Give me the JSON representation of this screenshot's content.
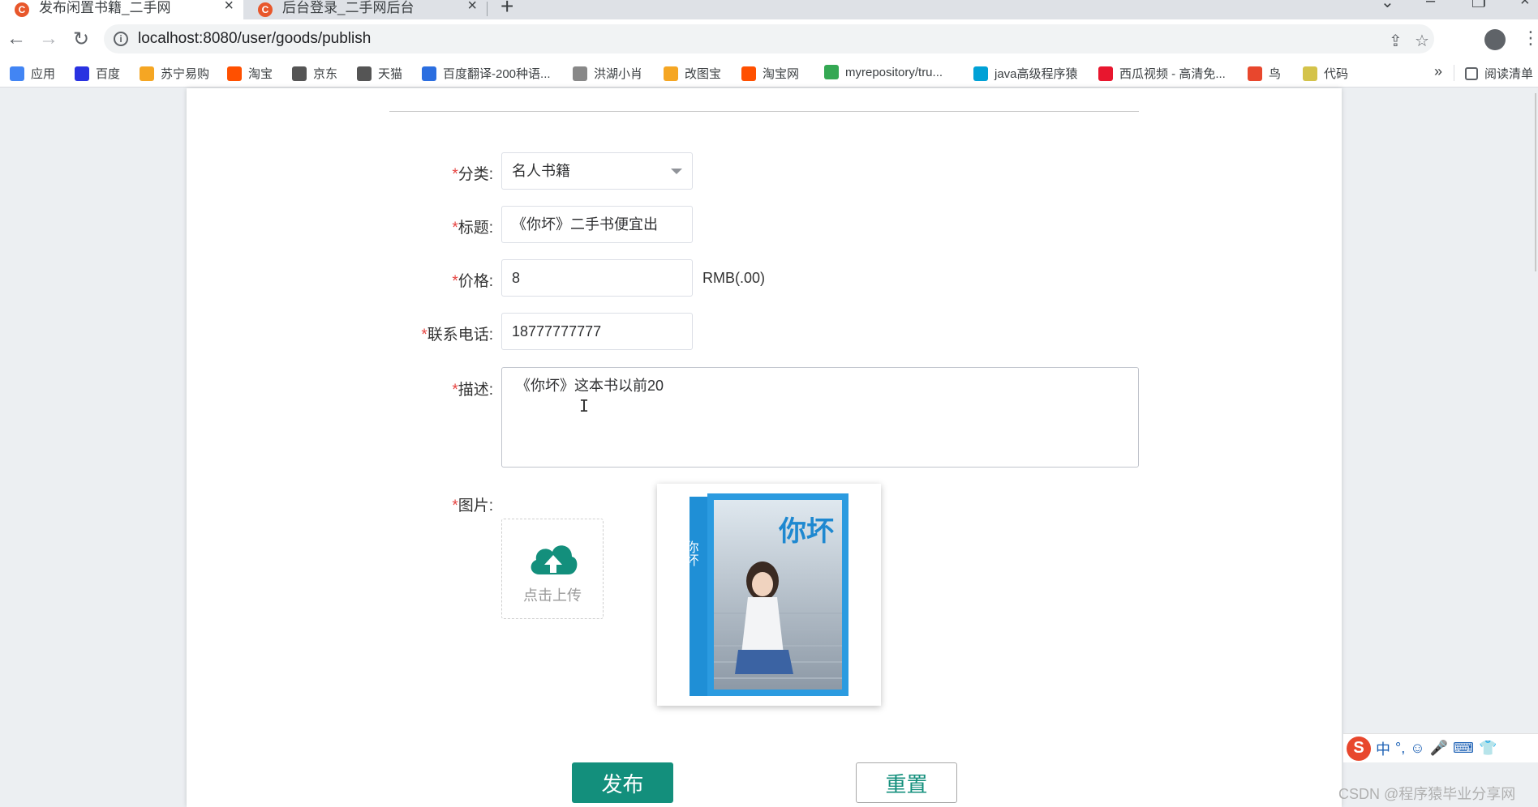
{
  "tabs": [
    {
      "title": "发布闲置书籍_二手网",
      "active": true
    },
    {
      "title": "后台登录_二手网后台",
      "active": false
    }
  ],
  "omnibox": {
    "url": "localhost:8080/user/goods/publish"
  },
  "bookmarks": [
    {
      "label": "应用",
      "icon": "apps-grid-icon",
      "color": "#4285f4"
    },
    {
      "label": "百度",
      "icon": "baidu-paw-icon",
      "color": "#2932e1"
    },
    {
      "label": "苏宁易购",
      "icon": "suning-icon",
      "color": "#f5a623"
    },
    {
      "label": "淘宝",
      "icon": "taobao-icon",
      "color": "#ff5000"
    },
    {
      "label": "京东",
      "icon": "globe-icon",
      "color": "#555555"
    },
    {
      "label": "天猫",
      "icon": "globe-icon",
      "color": "#555555"
    },
    {
      "label": "百度翻译-200种语...",
      "icon": "translate-icon",
      "color": "#2b6ee0"
    },
    {
      "label": "洪湖小肖",
      "icon": "feather-icon",
      "color": "#888888"
    },
    {
      "label": "改图宝",
      "icon": "folder-icon",
      "color": "#f5a623"
    },
    {
      "label": "淘宝网",
      "icon": "taobao-icon",
      "color": "#ff5000"
    },
    {
      "label": "myrepository/tru...",
      "icon": "chrome-icon",
      "color": "#34a853"
    },
    {
      "label": "java高级程序猿",
      "icon": "bilibili-icon",
      "color": "#00a1d6"
    },
    {
      "label": "西瓜视频 - 高清免...",
      "icon": "play-icon",
      "color": "#e8162e"
    },
    {
      "label": "鸟",
      "icon": "bird-icon",
      "color": "#e8472d"
    },
    {
      "label": "代码",
      "icon": "code-icon",
      "color": "#d4c34a"
    }
  ],
  "bookmarks_more": "»",
  "reading_list": "阅读清单",
  "form": {
    "category": {
      "label": "分类:",
      "value": "名人书籍"
    },
    "title": {
      "label": "标题:",
      "value": "《你坏》二手书便宜出"
    },
    "price": {
      "label": "价格:",
      "value": "8",
      "suffix": "RMB(.00)"
    },
    "phone": {
      "label": "联系电话:",
      "value": "18777777777"
    },
    "description": {
      "label": "描述:",
      "value": "《你坏》这本书以前20"
    },
    "image": {
      "label": "图片:",
      "upload_text": "点击上传"
    },
    "required_mark": "*"
  },
  "preview_book": {
    "title_vertical": "你坏",
    "title_large": "你坏"
  },
  "buttons": {
    "publish": "发布",
    "reset": "重置"
  },
  "ime": {
    "items": [
      "中",
      "°,",
      "☺",
      "🎤",
      "⌨",
      "👕"
    ]
  },
  "watermark": "CSDN @程序猿毕业分享网",
  "colors": {
    "primary": "#138f7c",
    "required": "#e64340"
  }
}
